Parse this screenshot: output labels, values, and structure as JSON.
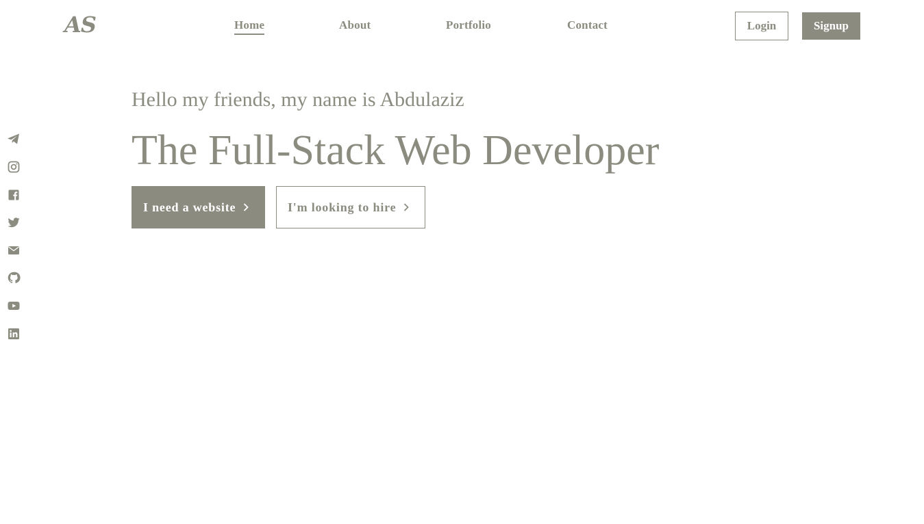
{
  "brand": {
    "logo_text": "AS"
  },
  "nav": {
    "items": [
      {
        "label": "Home",
        "active": true
      },
      {
        "label": "About",
        "active": false
      },
      {
        "label": "Portfolio",
        "active": false
      },
      {
        "label": "Contact",
        "active": false
      }
    ]
  },
  "auth": {
    "login_label": "Login",
    "signup_label": "Signup"
  },
  "social": {
    "icons": [
      "telegram-icon",
      "instagram-icon",
      "facebook-icon",
      "twitter-icon",
      "email-icon",
      "github-icon",
      "youtube-icon",
      "linkedin-icon"
    ]
  },
  "hero": {
    "greeting": "Hello my friends, my name is Abdulaziz",
    "headline": "The Full-Stack Web Developer",
    "primary_cta": "I need a website",
    "secondary_cta": "I'm looking to hire"
  },
  "colors": {
    "accent": "#8b8b80",
    "background": "#ffffff",
    "on_accent": "#ffffff"
  }
}
